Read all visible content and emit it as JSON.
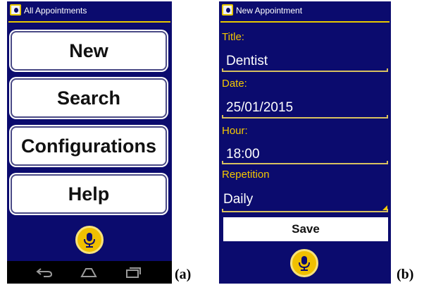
{
  "screen_a": {
    "title": "All Appointments",
    "buttons": {
      "new": "New",
      "search": "Search",
      "configurations": "Configurations",
      "help": "Help"
    },
    "mic_icon": "microphone-icon",
    "navbar_icons": [
      "back-icon",
      "home-icon",
      "recent-apps-icon"
    ]
  },
  "screen_b": {
    "title": "New Appointment",
    "fields": {
      "title_label": "Title:",
      "title_value": "Dentist",
      "date_label": "Date:",
      "date_value": "25/01/2015",
      "hour_label": "Hour:",
      "hour_value": "18:00",
      "repetition_label": "Repetition",
      "repetition_value": "Daily"
    },
    "save_label": "Save",
    "mic_icon": "microphone-icon"
  },
  "captions": {
    "a": "(a)",
    "b": "(b)"
  },
  "colors": {
    "screen_background": "#0b0b6e",
    "accent_yellow": "#f4c800",
    "button_background": "#ffffff"
  }
}
